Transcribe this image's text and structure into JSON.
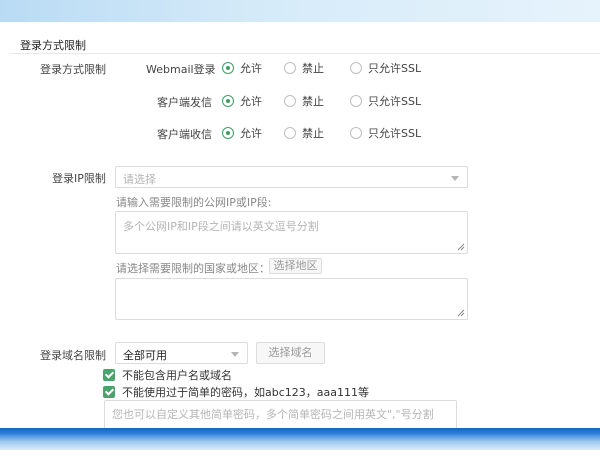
{
  "section": {
    "title": "登录方式限制"
  },
  "login_method": {
    "label": "登录方式限制",
    "rows": [
      {
        "name": "Webmail登录",
        "options": [
          "允许",
          "禁止",
          "只允许SSL"
        ],
        "selected": "允许"
      },
      {
        "name": "客户端发信",
        "options": [
          "允许",
          "禁止",
          "只允许SSL"
        ],
        "selected": "允许"
      },
      {
        "name": "客户端收信",
        "options": [
          "允许",
          "禁止",
          "只允许SSL"
        ],
        "selected": "允许"
      }
    ]
  },
  "ip_limit": {
    "label": "登录IP限制",
    "select_placeholder": "请选择",
    "ip_hint": "请输入需要限制的公网IP或IP段:",
    "ip_textarea_placeholder": "多个公网IP和IP段之间请以英文逗号分割",
    "region_hint": "请选择需要限制的国家或地区：",
    "region_button": "选择地区"
  },
  "domain_limit": {
    "label": "登录域名限制",
    "select_value": "全部可用",
    "select_button": "选择域名"
  },
  "password_rules": {
    "rule1": "不能包含用户名或域名",
    "rule2": "不能使用过于简单的密码，如abc123，aaa111等",
    "custom_placeholder": "您也可以自定义其他简单密码，多个简单密码之间用英文\",\"号分割"
  },
  "colors": {
    "accent": "#3e9e64",
    "checkbox": "#4aa36d",
    "band_blue": "#1565c0"
  }
}
